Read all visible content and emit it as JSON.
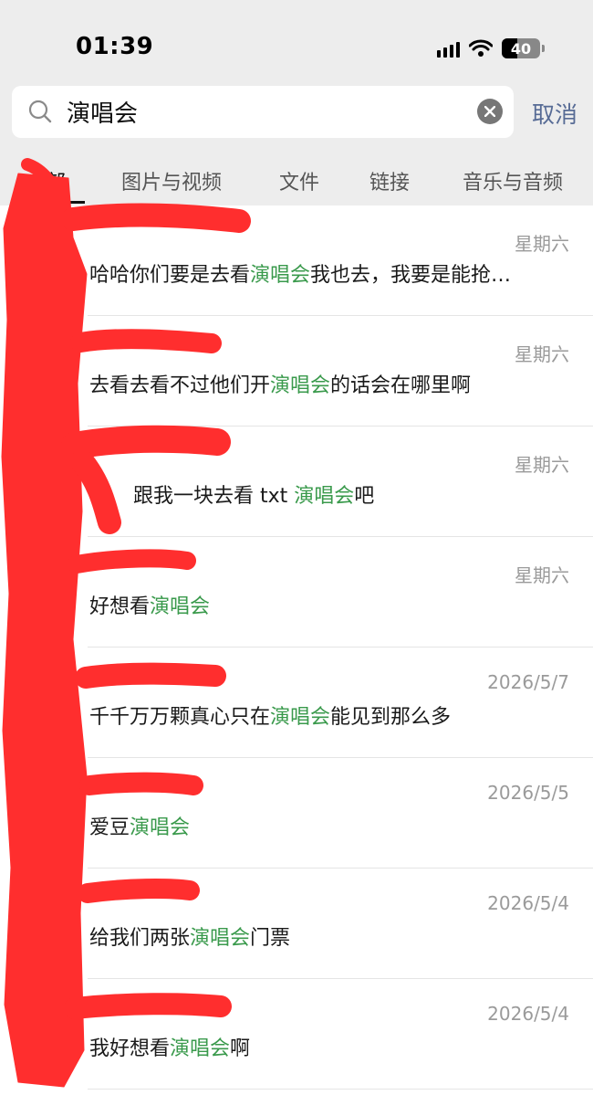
{
  "status_bar": {
    "time": "01:39",
    "battery": "40",
    "battery_level": 0.4
  },
  "search": {
    "query": "演唱会",
    "cancel_label": "取消"
  },
  "tabs": [
    {
      "label": "全部",
      "active": true
    },
    {
      "label": "图片与视频",
      "active": false
    },
    {
      "label": "文件",
      "active": false
    },
    {
      "label": "链接",
      "active": false
    },
    {
      "label": "音乐与音频",
      "active": false
    }
  ],
  "results": [
    {
      "time": "星期六",
      "msg_before": "哈哈你们要是去看",
      "keyword": "演唱会",
      "msg_after": "我也去，我要是能抢…"
    },
    {
      "time": "星期六",
      "msg_before": "去看去看不过他们开",
      "keyword": "演唱会",
      "msg_after": "的话会在哪里啊"
    },
    {
      "time": "星期六",
      "msg_before": "跟我一块去看 txt ",
      "keyword": "演唱会",
      "msg_after": "吧"
    },
    {
      "time": "星期六",
      "msg_before": "好想看",
      "keyword": "演唱会",
      "msg_after": ""
    },
    {
      "time": "2026/5/7",
      "msg_before": "千千万万颗真心只在",
      "keyword": "演唱会",
      "msg_after": "能见到那么多"
    },
    {
      "time": "2026/5/5",
      "msg_before": "爱豆",
      "keyword": "演唱会",
      "msg_after": ""
    },
    {
      "time": "2026/5/4",
      "msg_before": "给我们两张",
      "keyword": "演唱会",
      "msg_after": "门票"
    },
    {
      "time": "2026/5/4",
      "msg_before": "我好想看",
      "keyword": "演唱会",
      "msg_after": "啊"
    }
  ],
  "colors": {
    "highlight": "#3a9a4c",
    "cancel": "#576b95",
    "redaction": "#ff2e2e"
  }
}
